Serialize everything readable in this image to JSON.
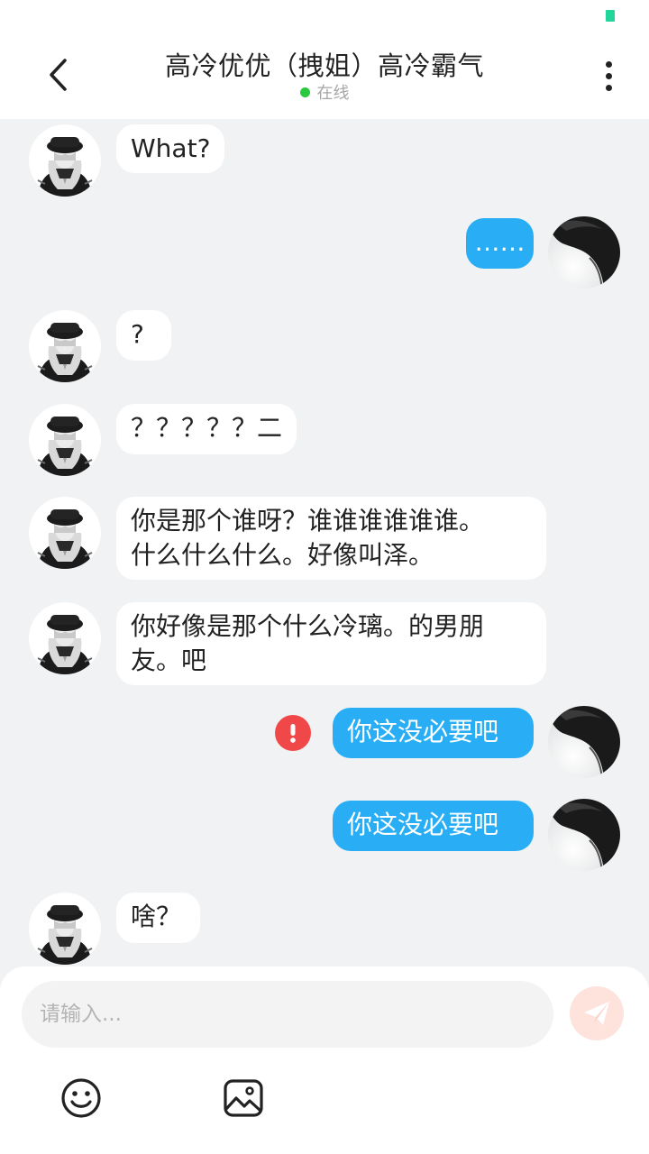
{
  "header": {
    "title": "高冷优优（拽姐）高冷霸气",
    "status": "在线"
  },
  "messages": [
    {
      "side": "in",
      "text": "What?"
    },
    {
      "side": "out",
      "text": "……"
    },
    {
      "side": "in",
      "text": "?"
    },
    {
      "side": "in",
      "text": "？？？？？二"
    },
    {
      "side": "in",
      "line1": "你是那个谁呀？谁谁谁谁谁谁。",
      "line2": "什么什么什么。好像叫泽。"
    },
    {
      "side": "in",
      "line1": "你好像是那个什么冷璃。的男朋",
      "line2": "友。吧"
    },
    {
      "side": "out",
      "text": "你这没必要吧",
      "failed": true
    },
    {
      "side": "out",
      "text": "你这没必要吧"
    },
    {
      "side": "in",
      "text": "啥？"
    }
  ],
  "composer": {
    "placeholder": "请输入..."
  },
  "icons": {
    "back": "chevron-left-icon",
    "more": "more-vertical-icon",
    "error": "exclamation-icon",
    "send": "paper-plane-icon",
    "emoji": "smiley-icon",
    "image": "image-icon"
  },
  "colors": {
    "outgoing_bubble": "#29aef5",
    "incoming_bubble": "#ffffff",
    "background": "#f1f2f3",
    "online_dot": "#28c840",
    "error": "#f04848",
    "send_button": "#fde3dc"
  }
}
